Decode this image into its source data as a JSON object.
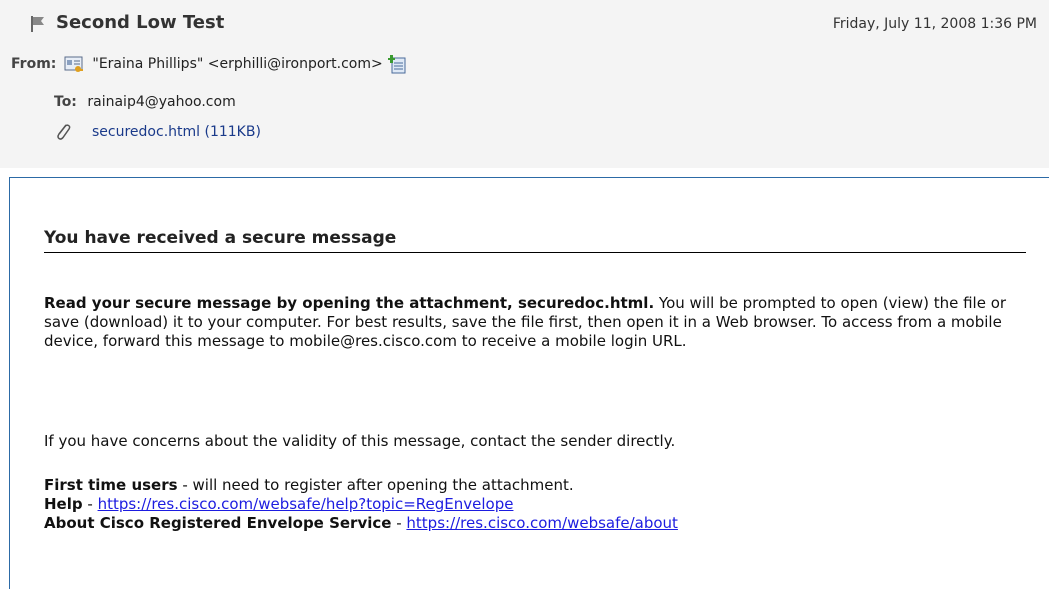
{
  "header": {
    "subject": "Second Low Test",
    "date": "Friday, July 11, 2008 1:36 PM",
    "from_label": "From:",
    "from_value": "\"Eraina Phillips\" <erphilli@ironport.com>",
    "to_label": "To:",
    "to_value": "rainaip4@yahoo.com",
    "attachment": "securedoc.html (111KB)",
    "icons": {
      "flag": "flag-icon",
      "vcard": "vcard-icon",
      "add_contact": "add-to-address-book-icon",
      "attachment": "paperclip-icon"
    }
  },
  "body": {
    "heading": "You have received a secure message",
    "p1_bold": "Read your secure message by opening the attachment, securedoc.html.",
    "p1_rest": " You will be prompted to open (view) the file or save (download) it to your computer. For best results, save the file first, then open it in a Web browser. To access from a mobile device, forward this message to mobile@res.cisco.com to receive a mobile login URL.",
    "p2": "If you have concerns about the validity of this message, contact the sender directly.",
    "first_time_bold": "First time users",
    "first_time_rest": " - will need to register after opening the attachment.",
    "help_bold": "Help",
    "help_sep": " - ",
    "help_link": "https://res.cisco.com/websafe/help?topic=RegEnvelope",
    "about_bold": "About Cisco Registered Envelope Service",
    "about_sep": " - ",
    "about_link": "https://res.cisco.com/websafe/about"
  },
  "colors": {
    "header_bg": "#f4f4f4",
    "frame_border": "#2c6aa6",
    "link": "#1c1ce0",
    "attachment_link": "#1a3a8a"
  }
}
